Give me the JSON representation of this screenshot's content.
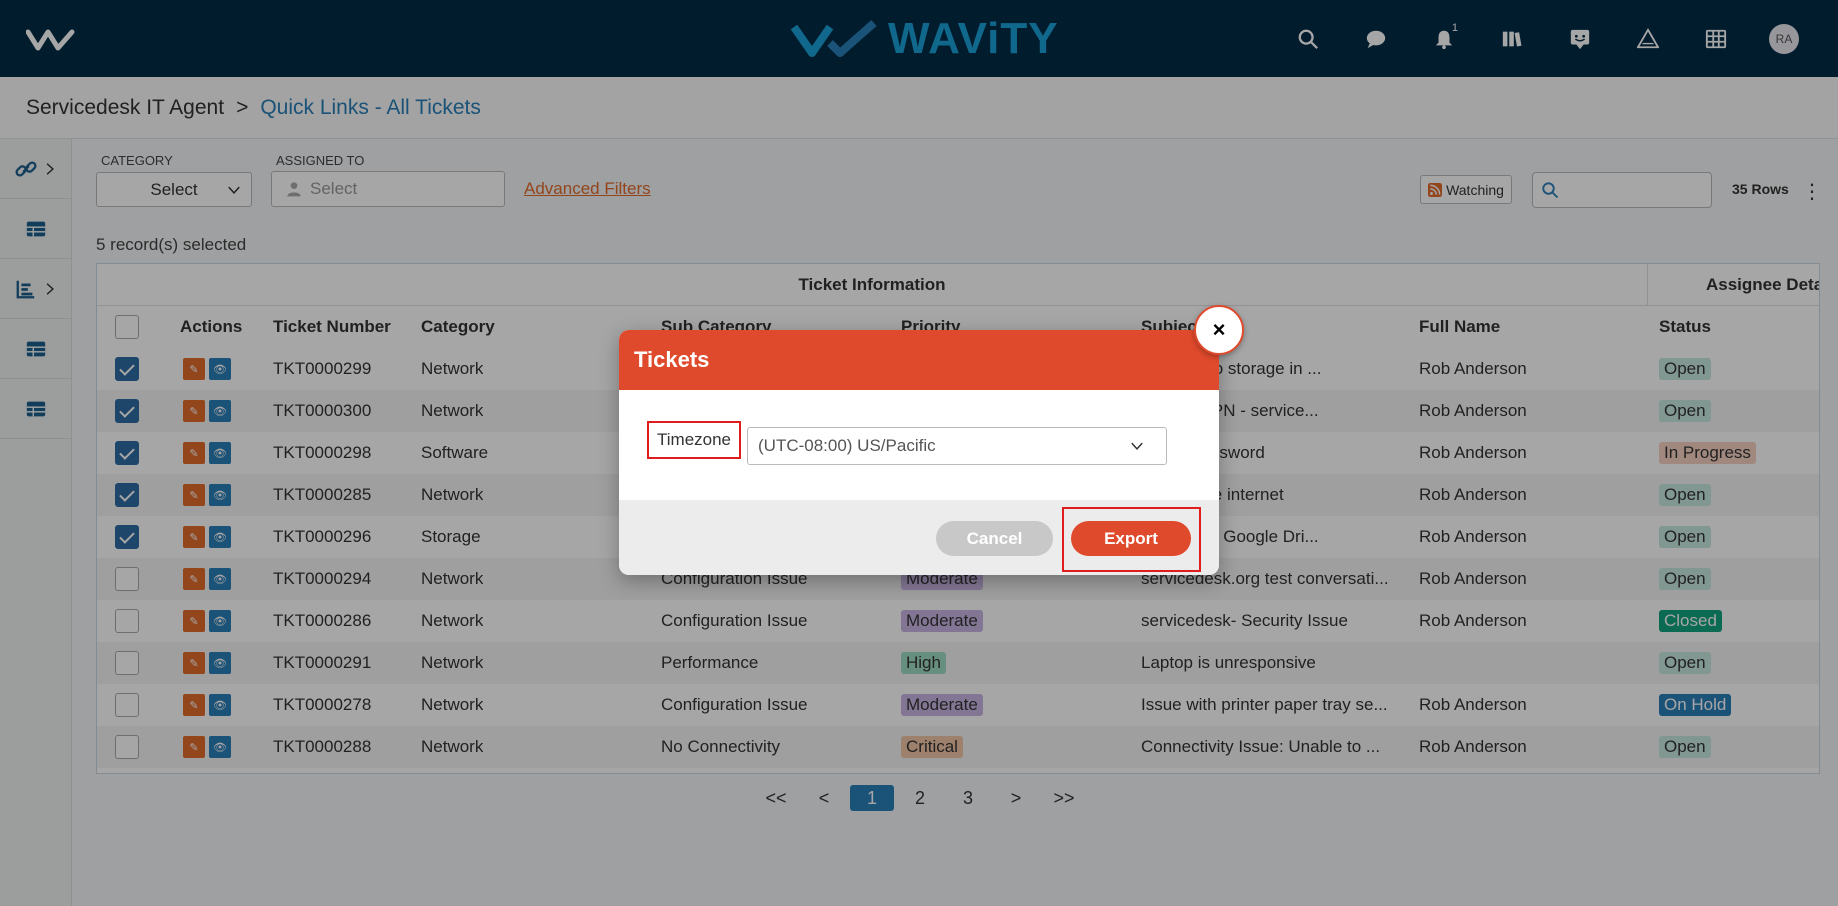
{
  "brand": {
    "name": "WAViTY"
  },
  "topbar": {
    "notification_count": "1",
    "avatar_initials": "RA"
  },
  "breadcrumb": {
    "root": "Servicedesk IT Agent",
    "separator": ">",
    "current": "Quick Links - All Tickets"
  },
  "filters": {
    "category_label": "CATEGORY",
    "category_value": "Select",
    "assigned_label": "ASSIGNED TO",
    "assigned_placeholder": "Select",
    "advanced_filters": "Advanced Filters",
    "watching": "Watching",
    "rows_count": "35 Rows"
  },
  "selected_count": "5 record(s) selected",
  "table": {
    "group_headers": [
      "Ticket Information",
      "Assignee Details"
    ],
    "columns": [
      "Actions",
      "Ticket Number",
      "Category",
      "Sub Category",
      "Priority",
      "Subject",
      "Full Name",
      "Status"
    ],
    "rows": [
      {
        "checked": true,
        "ticket": "TKT0000299",
        "category": "Network",
        "sub": "",
        "priority": "",
        "subject": "sk.org : No storage in ...",
        "name": "Rob Anderson",
        "status": "Open"
      },
      {
        "checked": true,
        "ticket": "TKT0000300",
        "category": "Network",
        "sub": "",
        "priority": "",
        "subject": "Access VPN - service...",
        "name": "Rob Anderson",
        "status": "Open"
      },
      {
        "checked": true,
        "ticket": "TKT0000298",
        "category": "Software",
        "sub": "",
        "priority": "",
        "subject": "Reset Password",
        "name": "Rob Anderson",
        "status": "In Progress"
      },
      {
        "checked": true,
        "ticket": "TKT0000285",
        "category": "Network",
        "sub": "",
        "priority": "",
        "subject": "access the internet",
        "name": "Rob Anderson",
        "status": "Open"
      },
      {
        "checked": true,
        "ticket": "TKT0000296",
        "category": "Storage",
        "sub": "",
        "priority": "",
        "subject": "e space in Google Dri...",
        "name": "Rob Anderson",
        "status": "Open"
      },
      {
        "checked": false,
        "ticket": "TKT0000294",
        "category": "Network",
        "sub": "Configuration Issue",
        "priority": "Moderate",
        "subject": "servicedesk.org test conversati...",
        "name": "Rob Anderson",
        "status": "Open"
      },
      {
        "checked": false,
        "ticket": "TKT0000286",
        "category": "Network",
        "sub": "Configuration Issue",
        "priority": "Moderate",
        "subject": "servicedesk- Security Issue",
        "name": "Rob Anderson",
        "status": "Closed"
      },
      {
        "checked": false,
        "ticket": "TKT0000291",
        "category": "Network",
        "sub": "Performance",
        "priority": "High",
        "subject": "Laptop is unresponsive",
        "name": "",
        "status": "Open"
      },
      {
        "checked": false,
        "ticket": "TKT0000278",
        "category": "Network",
        "sub": "Configuration Issue",
        "priority": "Moderate",
        "subject": "Issue with printer paper tray se...",
        "name": "Rob Anderson",
        "status": "On Hold"
      },
      {
        "checked": false,
        "ticket": "TKT0000288",
        "category": "Network",
        "sub": "No Connectivity",
        "priority": "Critical",
        "subject": "Connectivity Issue: Unable to ...",
        "name": "Rob Anderson",
        "status": "Open"
      }
    ]
  },
  "pagination": {
    "first": "<<",
    "prev": "<",
    "pages": [
      "1",
      "2",
      "3"
    ],
    "active": "1",
    "next": ">",
    "last": ">>"
  },
  "modal": {
    "title": "Tickets",
    "timezone_label": "Timezone",
    "timezone_value": "(UTC-08:00) US/Pacific",
    "cancel": "Cancel",
    "export": "Export",
    "close": "×"
  },
  "colors": {
    "topbar": "#002b45",
    "accent": "#e04a2c",
    "link": "#2a7fb8",
    "priority_moderate": "#c9b6e4",
    "priority_high": "#9fdcc4",
    "priority_critical": "#f3c6a8",
    "status_open": "#c6e8df",
    "status_progress": "#f6d2c2",
    "status_closed": "#10a37f",
    "status_hold": "#2a7fb8"
  }
}
